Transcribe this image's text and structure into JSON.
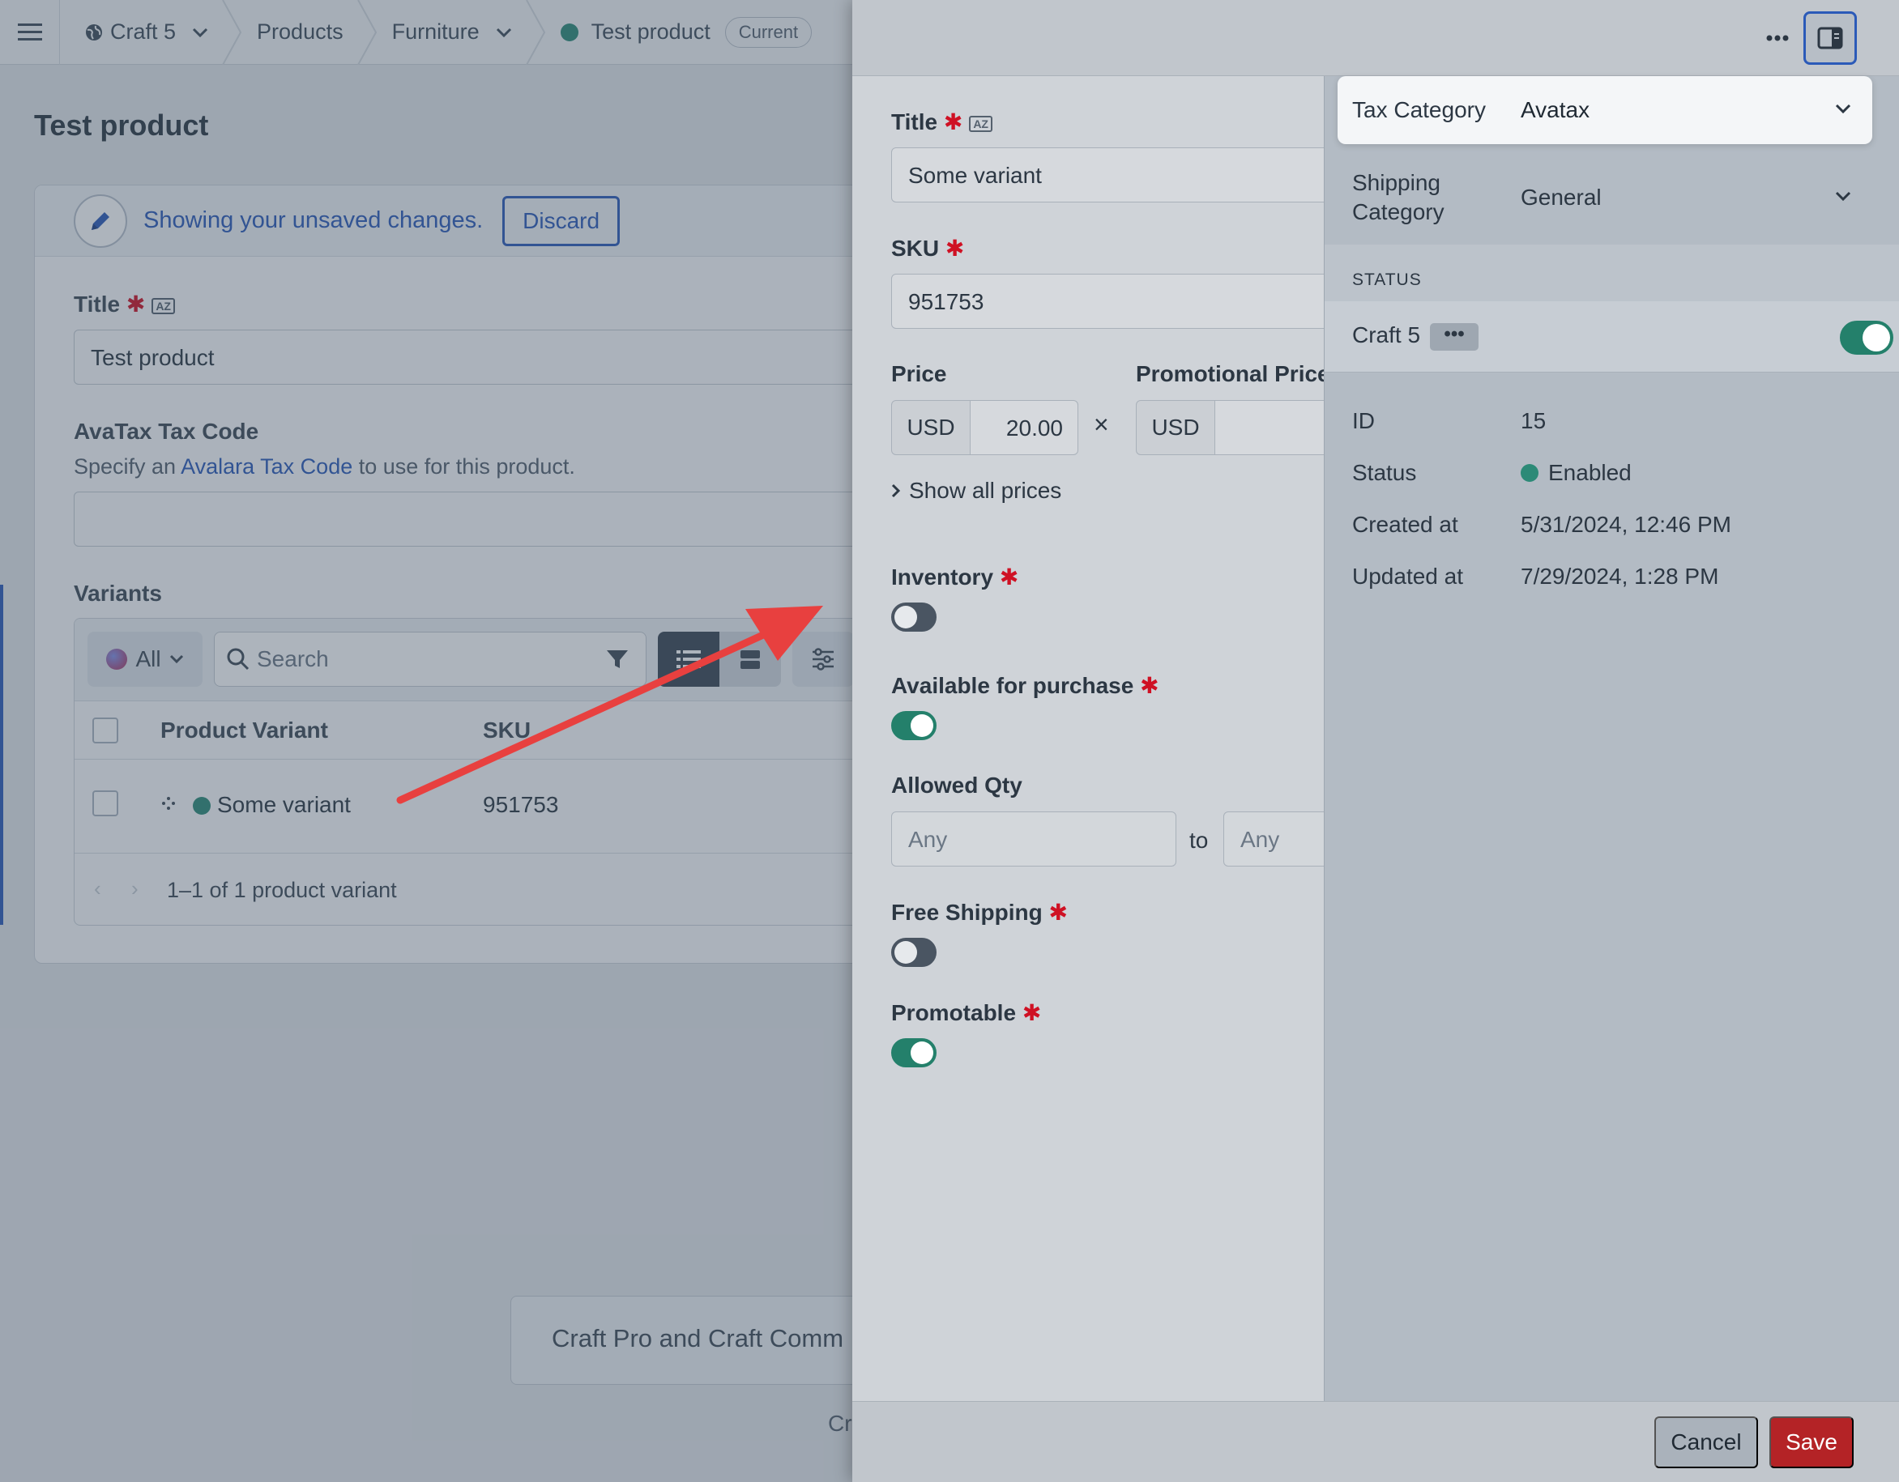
{
  "topbar": {
    "site": "Craft 5",
    "crumb_products": "Products",
    "crumb_furniture": "Furniture",
    "crumb_product": "Test product",
    "revision_badge": "Current"
  },
  "page": {
    "title": "Test product",
    "notice": "Showing your unsaved changes.",
    "discard_label": "Discard",
    "title_label": "Title",
    "title_value": "Test product",
    "avatax_label": "AvaTax Tax Code",
    "avatax_help_prefix": "Specify an ",
    "avatax_help_link": "Avalara Tax Code",
    "avatax_help_suffix": " to use for this product.",
    "variants_label": "Variants",
    "site_filter": "All",
    "search_placeholder": "Search",
    "col_variant": "Product Variant",
    "col_sku": "SKU",
    "row_variant": "Some variant",
    "row_sku": "951753",
    "pagination": "1–1 of 1 product variant",
    "promo_text": "Craft Pro and Craft Comm",
    "credit_text": "Cr"
  },
  "editor": {
    "title_label": "Title",
    "title_value": "Some variant",
    "sku_label": "SKU",
    "sku_value": "951753",
    "price_label": "Price",
    "price_currency": "USD",
    "price_value": "20.00",
    "promo_price_label": "Promotional Price",
    "promo_currency": "USD",
    "show_all_prices": "Show all prices",
    "inventory_label": "Inventory",
    "inventory_on": false,
    "available_label": "Available for purchase",
    "available_on": true,
    "allowed_qty_label": "Allowed Qty",
    "qty_min_placeholder": "Any",
    "qty_to": "to",
    "qty_max_placeholder": "Any",
    "free_shipping_label": "Free Shipping",
    "free_shipping_on": false,
    "promotable_label": "Promotable",
    "promotable_on": true,
    "cancel_label": "Cancel",
    "save_label": "Save"
  },
  "meta": {
    "tax_category_label": "Tax Category",
    "tax_category_value": "Avatax",
    "shipping_category_label": "Shipping Category",
    "shipping_category_value": "General",
    "status_heading": "STATUS",
    "site_name": "Craft 5",
    "site_enabled": true,
    "id_label": "ID",
    "id_value": "15",
    "status_label": "Status",
    "status_value": "Enabled",
    "created_label": "Created at",
    "created_value": "5/31/2024, 12:46 PM",
    "updated_label": "Updated at",
    "updated_value": "7/29/2024, 1:28 PM"
  },
  "colors": {
    "accent": "#2b5ab8",
    "enabled_green": "#24806b",
    "save_red": "#b42326",
    "annotation_arrow": "#e8403f"
  }
}
